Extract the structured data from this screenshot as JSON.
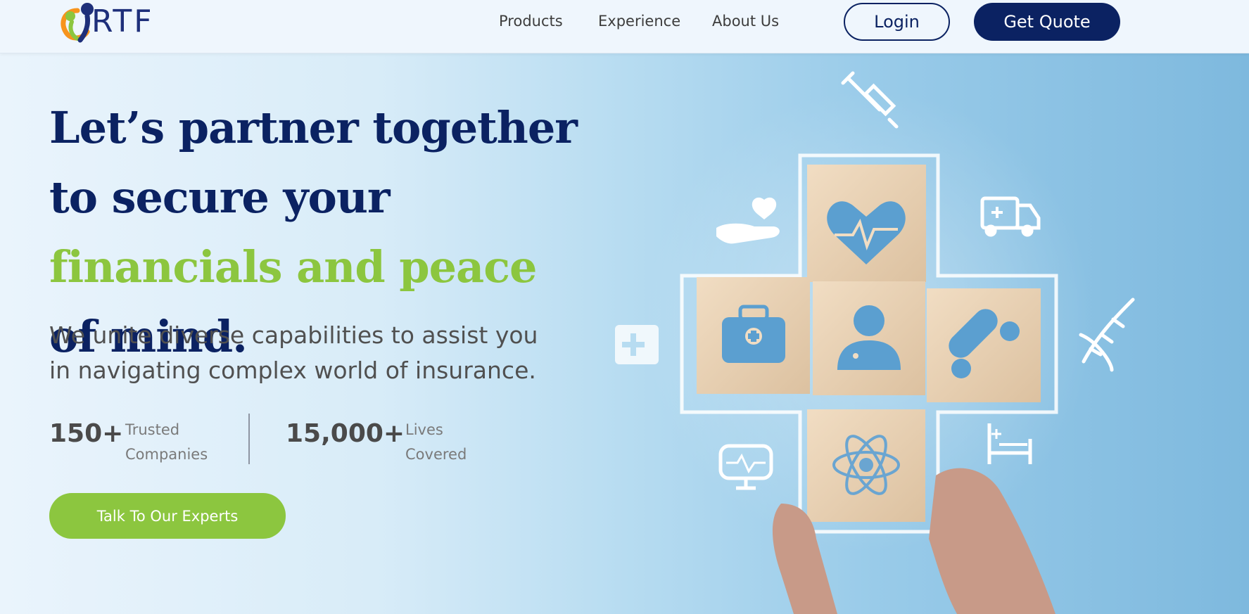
{
  "header": {
    "logo_text": "RTF",
    "nav": [
      {
        "label": "Products"
      },
      {
        "label": "Experience"
      },
      {
        "label": "About Us"
      }
    ],
    "login_label": "Login",
    "quote_label": "Get Quote"
  },
  "hero": {
    "headline": {
      "part1": "Let’s partner together to secure your ",
      "highlight": "financials and peace",
      "part2": " of mind."
    },
    "subtitle": "We unite diverse capabilities to assist you in navigating complex world of insurance.",
    "stats": [
      {
        "value": "150+",
        "label_line1": "Trusted",
        "label_line2": "Companies"
      },
      {
        "value": "15,000+",
        "label_line1": "Lives",
        "label_line2": "Covered"
      }
    ],
    "cta_label": "Talk To Our Experts"
  },
  "colors": {
    "navy": "#0b2262",
    "green": "#8cc63f",
    "logo_orange": "#f7941d",
    "logo_green": "#8cc63f",
    "logo_blue": "#1e2f7a"
  },
  "illustration": {
    "block_icons": [
      "heart-pulse-icon",
      "medical-kit-icon",
      "doctor-icon",
      "pill-icon",
      "atom-icon"
    ],
    "floating_icons": [
      "syringe-icon",
      "hand-heart-icon",
      "ambulance-icon",
      "first-aid-box-icon",
      "dna-icon",
      "monitor-pulse-icon",
      "hospital-bed-icon"
    ]
  }
}
